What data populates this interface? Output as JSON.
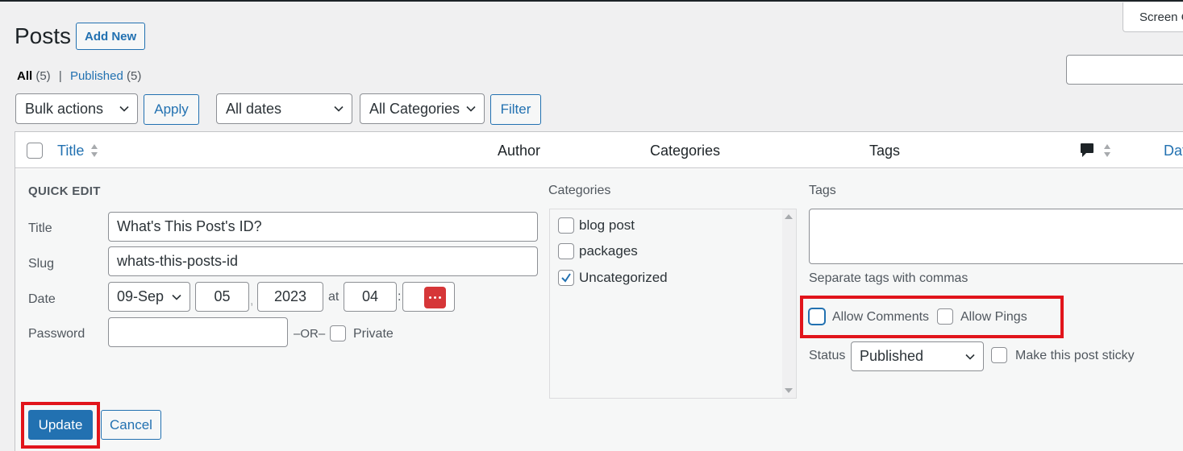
{
  "header": {
    "title": "Posts",
    "add_new_label": "Add New",
    "screen_options_label": "Screen O"
  },
  "views": {
    "all_label": "All",
    "all_count": "(5)",
    "separator": "|",
    "published_label": "Published",
    "published_count": "(5)"
  },
  "filters": {
    "bulk_actions": "Bulk actions",
    "apply_label": "Apply",
    "dates": "All dates",
    "categories": "All Categories",
    "filter_label": "Filter"
  },
  "table": {
    "columns": {
      "title": "Title",
      "author": "Author",
      "categories": "Categories",
      "tags": "Tags",
      "date": "Date"
    }
  },
  "quick_edit": {
    "heading": "QUICK EDIT",
    "title_label": "Title",
    "title_value": "What's This Post's ID?",
    "slug_label": "Slug",
    "slug_value": "whats-this-posts-id",
    "date_label": "Date",
    "month": "09-Sep",
    "day": "05",
    "comma": ",",
    "year": "2023",
    "at": "at",
    "hour": "04",
    "colon": ":",
    "password_label": "Password",
    "or_label": "–OR–",
    "private_label": "Private",
    "categories_label": "Categories",
    "categories": [
      {
        "name": "blog post",
        "checked": false
      },
      {
        "name": "packages",
        "checked": false
      },
      {
        "name": "Uncategorized",
        "checked": true
      }
    ],
    "tags_label": "Tags",
    "tags_hint": "Separate tags with commas",
    "allow_comments_label": "Allow Comments",
    "allow_pings_label": "Allow Pings",
    "status_label": "Status",
    "status_value": "Published",
    "sticky_label": "Make this post sticky",
    "update_label": "Update",
    "cancel_label": "Cancel"
  },
  "colors": {
    "accent": "#2271b1",
    "highlight": "#e1141b",
    "background": "#f0f0f1"
  }
}
